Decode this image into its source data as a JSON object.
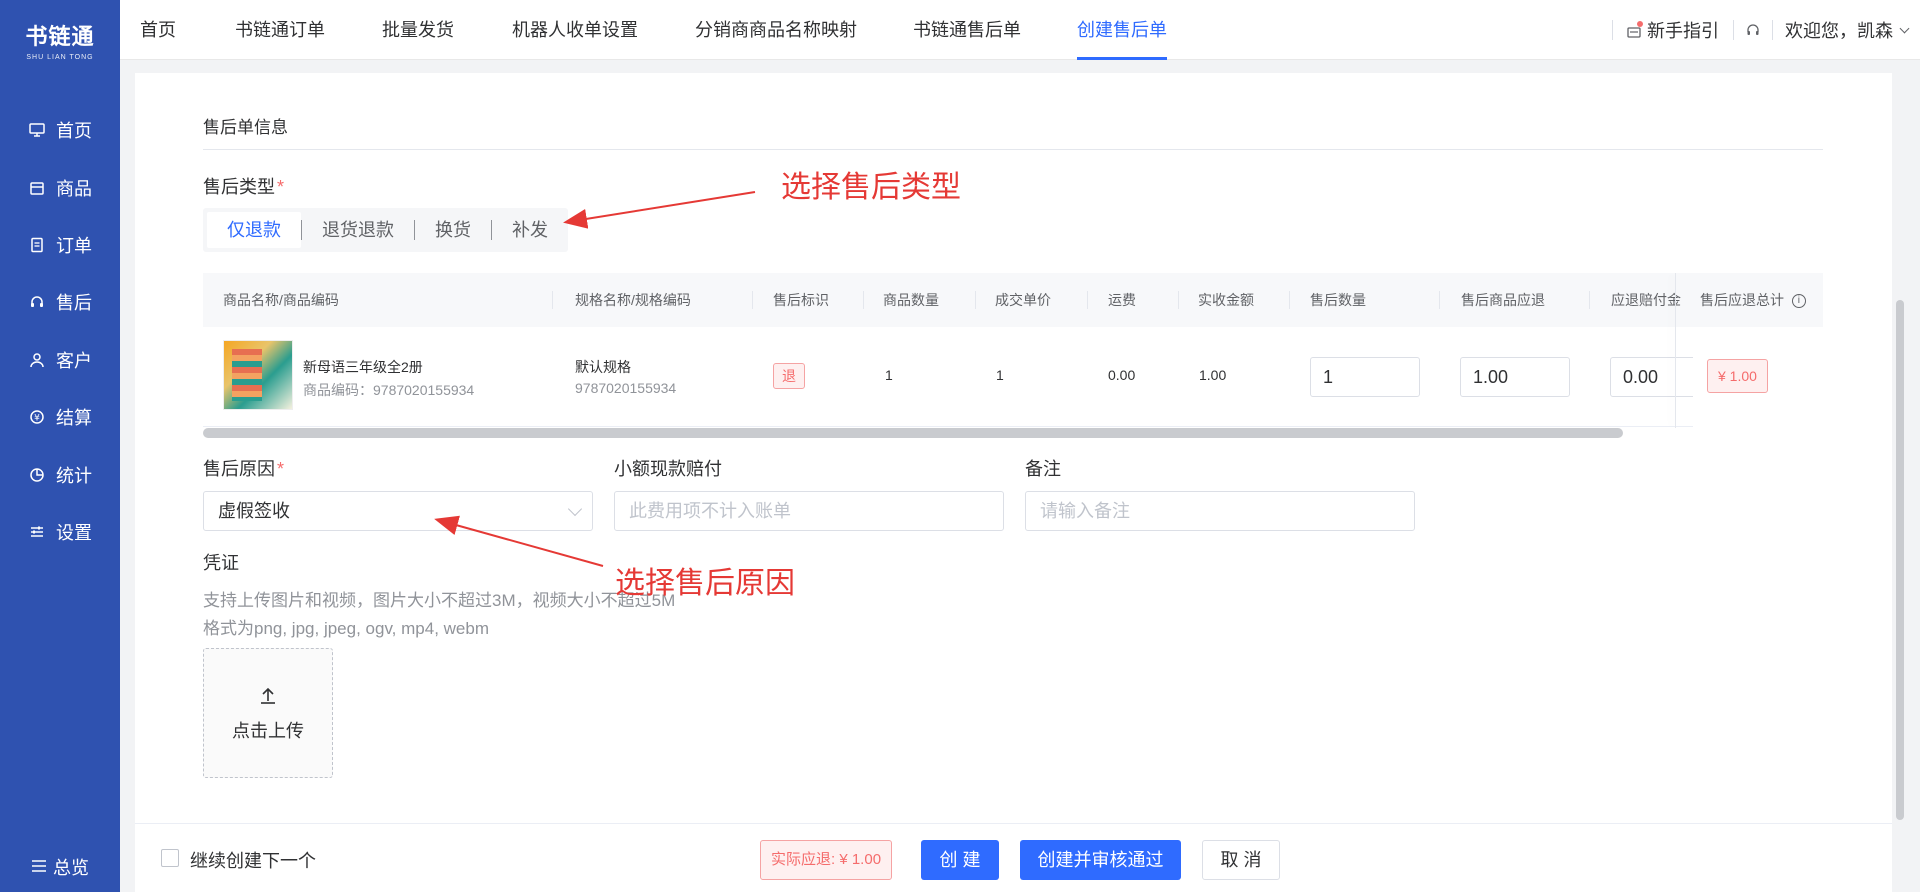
{
  "sidebar": {
    "logo_main": "书链通",
    "logo_sub": "SHU LIAN TONG",
    "items": [
      {
        "label": "首页",
        "icon": "monitor-icon"
      },
      {
        "label": "商品",
        "icon": "box-icon"
      },
      {
        "label": "订单",
        "icon": "order-icon"
      },
      {
        "label": "售后",
        "icon": "headset-icon"
      },
      {
        "label": "客户",
        "icon": "user-icon"
      },
      {
        "label": "结算",
        "icon": "settle-icon"
      },
      {
        "label": "统计",
        "icon": "pie-icon"
      },
      {
        "label": "设置",
        "icon": "sliders-icon"
      }
    ],
    "bottom_label": "总览"
  },
  "topnav": {
    "tabs": [
      "首页",
      "书链通订单",
      "批量发货",
      "机器人收单设置",
      "分销商商品名称映射",
      "书链通售后单",
      "创建售后单"
    ],
    "active_tab": "创建售后单",
    "guide_label": "新手指引",
    "welcome": "欢迎您，凯森"
  },
  "form": {
    "section_title": "售后单信息",
    "type_label": "售后类型",
    "type_options": [
      "仅退款",
      "退货退款",
      "换货",
      "补发"
    ],
    "type_selected": "仅退款",
    "table": {
      "headers": [
        "商品名称/商品编码",
        "规格名称/规格编码",
        "售后标识",
        "商品数量",
        "成交单价",
        "运费",
        "实收金额",
        "售后数量",
        "售后商品应退",
        "应退赔付金",
        "售后应退总计"
      ],
      "row": {
        "name": "新母语三年级全2册",
        "code_label": "商品编码：9787020155934",
        "spec_name": "默认规格",
        "spec_code": "9787020155934",
        "tag": "退",
        "qty": "1",
        "unit_price": "1",
        "freight": "0.00",
        "paid": "1.00",
        "aftersale_qty": "1",
        "refund_goods": "1.00",
        "refund_comp": "0.00",
        "total": "¥ 1.00"
      }
    },
    "reason_label": "售后原因",
    "reason_value": "虚假签收",
    "comp_label": "小额现款赔付",
    "comp_placeholder": "此费用项不计入账单",
    "remark_label": "备注",
    "remark_placeholder": "请输入备注",
    "voucher_label": "凭证",
    "voucher_hint1": "支持上传图片和视频，图片大小不超过3M，视频大小不超过5M",
    "voucher_hint2": "格式为png, jpg, jpeg, ogv, mp4, webm",
    "upload_label": "点击上传"
  },
  "annotations": {
    "type_note": "选择售后类型",
    "reason_note": "选择售后原因",
    "color": "#e53935"
  },
  "footer": {
    "continue_label": "继续创建下一个",
    "amount": "实际应退: ¥ 1.00",
    "create": "创 建",
    "create_approve": "创建并审核通过",
    "cancel": "取 消"
  },
  "colors": {
    "sidebar_bg": "#2f52b0",
    "accent": "#2f6bff",
    "danger": "#f56c6c"
  }
}
